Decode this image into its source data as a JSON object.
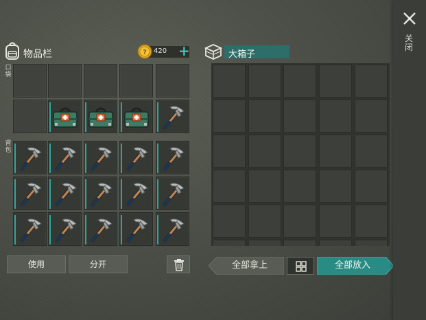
{
  "close": {
    "icon": "close-icon",
    "label": "关闭"
  },
  "inventory": {
    "title": "物品栏",
    "icon": "backpack-icon",
    "coins": "420",
    "coin_icon": "gold-coin-icon",
    "add_icon": "plus-icon",
    "pocket_label": "口袋",
    "backpack_label": "背包",
    "pocket_slots": [
      "empty",
      "empty",
      "empty",
      "empty",
      "empty",
      "empty",
      "toolbox",
      "toolbox",
      "toolbox",
      "pickaxe"
    ],
    "backpack_slots": [
      "pickaxe",
      "pickaxe",
      "pickaxe",
      "pickaxe",
      "pickaxe",
      "pickaxe",
      "pickaxe",
      "pickaxe",
      "pickaxe",
      "pickaxe",
      "pickaxe",
      "pickaxe",
      "pickaxe",
      "pickaxe",
      "pickaxe"
    ]
  },
  "chest": {
    "title": "大箱子",
    "icon": "chest-icon"
  },
  "buttons": {
    "use": "使用",
    "split": "分开",
    "trash_icon": "trash-icon",
    "take_all": "全部拿上",
    "sort_icon": "sort-grid-icon",
    "put_all": "全部放入"
  },
  "colors": {
    "accent": "#2fa59a",
    "chest_title_bg": "#2e6e6a",
    "put_all_bg": "#2a8a84"
  }
}
